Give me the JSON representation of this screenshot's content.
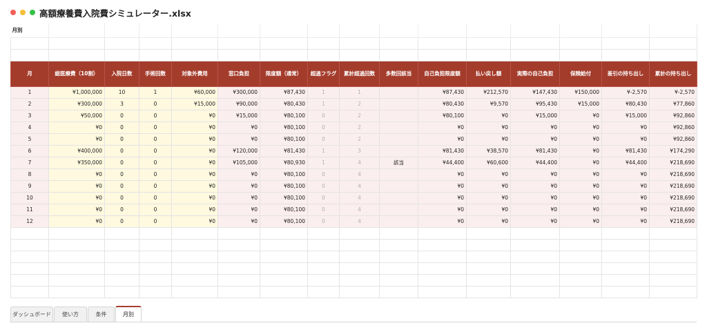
{
  "window": {
    "title": "高額療養費入院費シミュレーター.xlsx"
  },
  "sheet": {
    "title": "月別",
    "headers": [
      "月",
      "総医療費（10割）",
      "入院日数",
      "手術回数",
      "対象外費用",
      "窓口負担",
      "限度額（通常）",
      "超過フラグ",
      "累計超過回数",
      "多数回該当",
      "自己負担限度額",
      "払い戻し額",
      "実際の自己負担",
      "保険給付",
      "差引の持ち出し",
      "累計の持ち出し"
    ],
    "rows": [
      [
        "1",
        "¥1,000,000",
        "10",
        "1",
        "¥60,000",
        "¥300,000",
        "¥87,430",
        "1",
        "1",
        "",
        "¥87,430",
        "¥212,570",
        "¥147,430",
        "¥150,000",
        "¥-2,570",
        "¥-2,570"
      ],
      [
        "2",
        "¥300,000",
        "3",
        "0",
        "¥15,000",
        "¥90,000",
        "¥80,430",
        "1",
        "2",
        "",
        "¥80,430",
        "¥9,570",
        "¥95,430",
        "¥15,000",
        "¥80,430",
        "¥77,860"
      ],
      [
        "3",
        "¥50,000",
        "0",
        "0",
        "¥0",
        "¥15,000",
        "¥80,100",
        "0",
        "2",
        "",
        "¥80,100",
        "¥0",
        "¥15,000",
        "¥0",
        "¥15,000",
        "¥92,860"
      ],
      [
        "4",
        "¥0",
        "0",
        "0",
        "¥0",
        "¥0",
        "¥80,100",
        "0",
        "2",
        "",
        "¥0",
        "¥0",
        "¥0",
        "¥0",
        "¥0",
        "¥92,860"
      ],
      [
        "5",
        "¥0",
        "0",
        "0",
        "¥0",
        "¥0",
        "¥80,100",
        "0",
        "2",
        "",
        "¥0",
        "¥0",
        "¥0",
        "¥0",
        "¥0",
        "¥92,860"
      ],
      [
        "6",
        "¥400,000",
        "0",
        "0",
        "¥0",
        "¥120,000",
        "¥81,430",
        "1",
        "3",
        "",
        "¥81,430",
        "¥38,570",
        "¥81,430",
        "¥0",
        "¥81,430",
        "¥174,290"
      ],
      [
        "7",
        "¥350,000",
        "0",
        "0",
        "¥0",
        "¥105,000",
        "¥80,930",
        "1",
        "4",
        "該当",
        "¥44,400",
        "¥60,600",
        "¥44,400",
        "¥0",
        "¥44,400",
        "¥218,690"
      ],
      [
        "8",
        "¥0",
        "0",
        "0",
        "¥0",
        "¥0",
        "¥80,100",
        "0",
        "4",
        "",
        "¥0",
        "¥0",
        "¥0",
        "¥0",
        "¥0",
        "¥218,690"
      ],
      [
        "9",
        "¥0",
        "0",
        "0",
        "¥0",
        "¥0",
        "¥80,100",
        "0",
        "4",
        "",
        "¥0",
        "¥0",
        "¥0",
        "¥0",
        "¥0",
        "¥218,690"
      ],
      [
        "10",
        "¥0",
        "0",
        "0",
        "¥0",
        "¥0",
        "¥80,100",
        "0",
        "4",
        "",
        "¥0",
        "¥0",
        "¥0",
        "¥0",
        "¥0",
        "¥218,690"
      ],
      [
        "11",
        "¥0",
        "0",
        "0",
        "¥0",
        "¥0",
        "¥80,100",
        "0",
        "4",
        "",
        "¥0",
        "¥0",
        "¥0",
        "¥0",
        "¥0",
        "¥218,690"
      ],
      [
        "12",
        "¥0",
        "0",
        "0",
        "¥0",
        "¥0",
        "¥80,100",
        "0",
        "4",
        "",
        "¥0",
        "¥0",
        "¥0",
        "¥0",
        "¥0",
        "¥218,690"
      ]
    ]
  },
  "tabs": [
    {
      "label": "ダッシュボード",
      "active": false
    },
    {
      "label": "使い方",
      "active": false
    },
    {
      "label": "条件",
      "active": false
    },
    {
      "label": "月別",
      "active": true
    }
  ],
  "colors": {
    "header_bg": "#a43c2c",
    "title": "#8b2d24",
    "data_bg": "#fbeeee",
    "input_bg": "#fef9df"
  }
}
